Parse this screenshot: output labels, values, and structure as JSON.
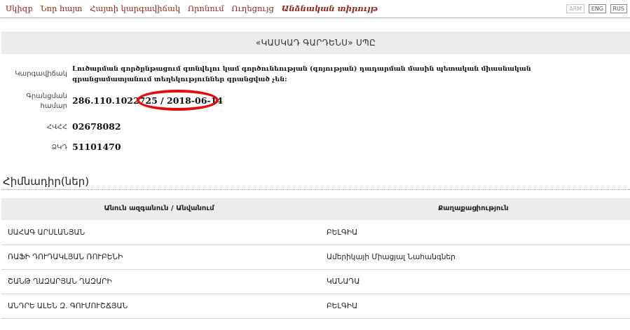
{
  "nav": {
    "items": [
      "Սկիզբ",
      "Նոր հայտ",
      "Հայտի կարգավիճակ",
      "Որոնում",
      "Ուղեցույց",
      "Անձնական տիրույթ"
    ],
    "languages": [
      "ARM",
      "ENG",
      "RUS"
    ]
  },
  "company": {
    "name": "«ԿԱՍԿԱԴ ԳԱՐԴԵՆՍ» ՍՊԸ"
  },
  "details": {
    "status_label": "Կարգավիճակ",
    "status_value": "Լուծարման գործընթացում գտնվելու կամ գործունեության (գոյության) դադարման մասին պետական միասնական գրանցամատյանում տեղեկություններ գրանցված չեն:",
    "reg_label": "Գրանցման համար",
    "reg_value": "286.110.1022725 / 2018-06-14",
    "tin_label": "ՀՎՀՀ",
    "tin_value": "02678082",
    "code_label": "ՁԿԴ",
    "code_value": "51101470"
  },
  "founders": {
    "title": "Հիմնադիր(ներ)",
    "col_name": "Անուն ազգանուն / Անվանում",
    "col_country": "Քաղաքացիություն",
    "rows": [
      {
        "name": "ՍԱՀԱԳ ԱՐՍԼԱՆՅԱՆ",
        "country": "ԲԵԼԳԻԱ"
      },
      {
        "name": "ՌԱՖԻ ԴՈՒԴԱԿԼՅԱՆ ՌՈՒԲԵՆԻ",
        "country": "Ամերիկայի Միացյալ Նահանգներ"
      },
      {
        "name": "ՇԱՆԹ ՂԱԶԱՐՅԱՆ ՂԱԶԱՐԻ",
        "country": "ԿԱՆԱԴԱ"
      },
      {
        "name": "ԱՆԴՐԵ ԱԼԵՆ Զ. ԳՈՒՄՈՒՇՃՅԱՆ",
        "country": "ԲԵԼԳԻԱ"
      }
    ]
  },
  "colors": {
    "nav_link": "#8b2a1a",
    "highlight_circle": "#e01010",
    "header_bg": "#ececec"
  }
}
